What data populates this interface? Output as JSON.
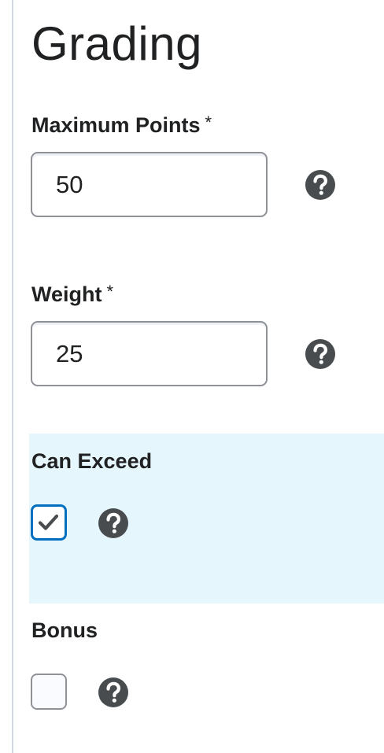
{
  "section": {
    "title": "Grading"
  },
  "fields": {
    "max_points": {
      "label": "Maximum Points",
      "required_mark": "*",
      "value": "50"
    },
    "weight": {
      "label": "Weight",
      "required_mark": "*",
      "value": "25"
    },
    "can_exceed": {
      "label": "Can Exceed",
      "checked": true
    },
    "bonus": {
      "label": "Bonus",
      "checked": false
    }
  },
  "icons": {
    "help": "help-question-circle-icon",
    "check": "checkmark-icon"
  },
  "colors": {
    "text": "#202122",
    "help_icon": "#494c4e",
    "focus_border": "#006fbf",
    "highlight_bg": "#e6f6fd",
    "input_border": "#8e9196"
  }
}
